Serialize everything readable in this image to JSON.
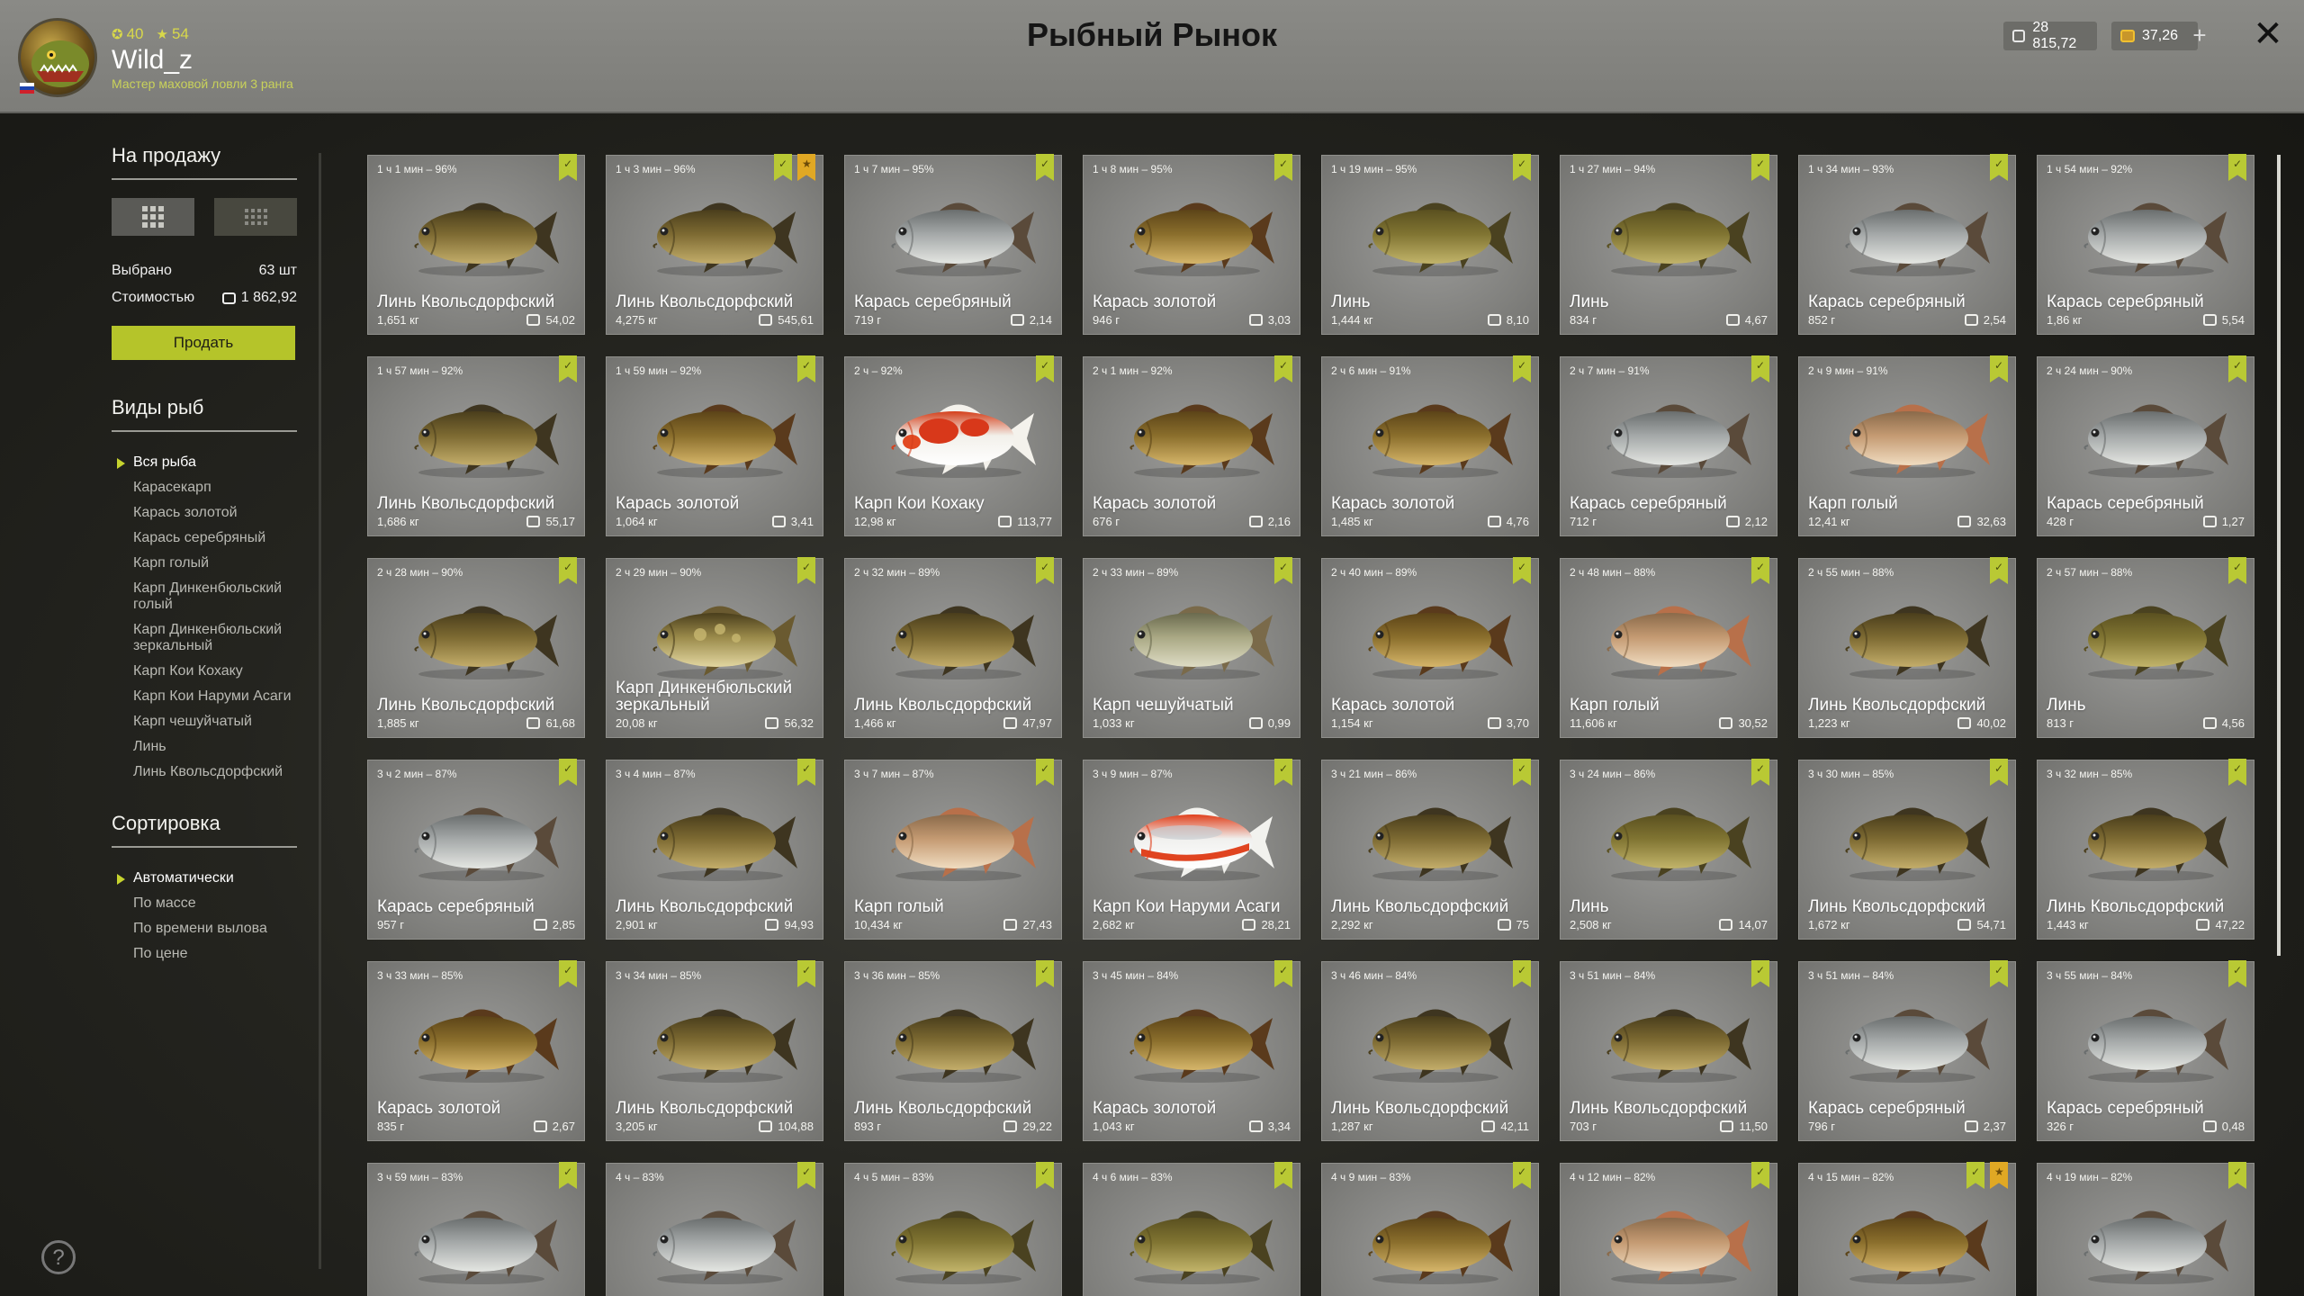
{
  "player": {
    "stat_a": "40",
    "stat_b": "54",
    "username": "Wild_z",
    "rank": "Мастер маховой ловли 3 ранга"
  },
  "title": "Рыбный Рынок",
  "currency": {
    "silver": "28 815,72",
    "gold": "37,26"
  },
  "sidebar": {
    "for_sale_title": "На продажу",
    "selected_label": "Выбрано",
    "selected_value": "63 шт",
    "cost_label": "Стоимостью",
    "cost_value": "1 862,92",
    "sell_label": "Продать",
    "fish_types_title": "Виды рыб",
    "fish_types": [
      "Вся рыба",
      "Карасекарп",
      "Карась золотой",
      "Карась серебряный",
      "Карп голый",
      "Карп Динкенбюльский голый",
      "Карп Динкенбюльский зеркальный",
      "Карп Кои Кохаку",
      "Карп Кои Наруми Асаги",
      "Карп чешуйчатый",
      "Линь",
      "Линь Квольсдорфский"
    ],
    "sort_title": "Сортировка",
    "sort_options": [
      "Автоматически",
      "По массе",
      "По времени вылова",
      "По цене"
    ]
  },
  "colors": {
    "accent": "#b5c42a",
    "tag_gold": "#e0a824"
  },
  "cards": [
    {
      "time": "1 ч 1 мин – 96%",
      "name": "Линь Квольсдорфский",
      "weight": "1,651 кг",
      "price": "54,02",
      "kind": "tench",
      "tags": 1
    },
    {
      "time": "1 ч 3 мин – 96%",
      "name": "Линь Квольсдорфский",
      "weight": "4,275 кг",
      "price": "545,61",
      "kind": "tench",
      "tags": 2
    },
    {
      "time": "1 ч 7 мин – 95%",
      "name": "Карась серебряный",
      "weight": "719 г",
      "price": "2,14",
      "kind": "silver",
      "tags": 1
    },
    {
      "time": "1 ч 8 мин – 95%",
      "name": "Карась золотой",
      "weight": "946 г",
      "price": "3,03",
      "kind": "gold",
      "tags": 1
    },
    {
      "time": "1 ч 19 мин – 95%",
      "name": "Линь",
      "weight": "1,444 кг",
      "price": "8,10",
      "kind": "tench2",
      "tags": 1
    },
    {
      "time": "1 ч 27 мин – 94%",
      "name": "Линь",
      "weight": "834 г",
      "price": "4,67",
      "kind": "tench2",
      "tags": 1
    },
    {
      "time": "1 ч 34 мин – 93%",
      "name": "Карась серебряный",
      "weight": "852 г",
      "price": "2,54",
      "kind": "silver",
      "tags": 1
    },
    {
      "time": "1 ч 54 мин – 92%",
      "name": "Карась серебряный",
      "weight": "1,86 кг",
      "price": "5,54",
      "kind": "silver",
      "tags": 1
    },
    {
      "time": "1 ч 57 мин – 92%",
      "name": "Линь Квольсдорфский",
      "weight": "1,686 кг",
      "price": "55,17",
      "kind": "tench",
      "tags": 1
    },
    {
      "time": "1 ч 59 мин – 92%",
      "name": "Карась золотой",
      "weight": "1,064 кг",
      "price": "3,41",
      "kind": "gold",
      "tags": 1
    },
    {
      "time": "2 ч – 92%",
      "name": "Карп Кои Кохаку",
      "weight": "12,98 кг",
      "price": "113,77",
      "kind": "koi",
      "tags": 1
    },
    {
      "time": "2 ч 1 мин – 92%",
      "name": "Карась золотой",
      "weight": "676 г",
      "price": "2,16",
      "kind": "gold",
      "tags": 1
    },
    {
      "time": "2 ч 6 мин – 91%",
      "name": "Карась золотой",
      "weight": "1,485 кг",
      "price": "4,76",
      "kind": "gold",
      "tags": 1
    },
    {
      "time": "2 ч 7 мин – 91%",
      "name": "Карась серебряный",
      "weight": "712 г",
      "price": "2,12",
      "kind": "silver",
      "tags": 1
    },
    {
      "time": "2 ч 9 мин – 91%",
      "name": "Карп голый",
      "weight": "12,41 кг",
      "price": "32,63",
      "kind": "leather",
      "tags": 1
    },
    {
      "time": "2 ч 24 мин – 90%",
      "name": "Карась серебряный",
      "weight": "428 г",
      "price": "1,27",
      "kind": "silver",
      "tags": 1
    },
    {
      "time": "2 ч 28 мин – 90%",
      "name": "Линь Квольсдорфский",
      "weight": "1,885 кг",
      "price": "61,68",
      "kind": "tench",
      "tags": 1
    },
    {
      "time": "2 ч 29 мин – 90%",
      "name": "Карп Динкенбюльский зеркальный",
      "weight": "20,08 кг",
      "price": "56,32",
      "kind": "mirror",
      "tags": 1
    },
    {
      "time": "2 ч 32 мин – 89%",
      "name": "Линь Квольсдорфский",
      "weight": "1,466 кг",
      "price": "47,97",
      "kind": "tench",
      "tags": 1
    },
    {
      "time": "2 ч 33 мин – 89%",
      "name": "Карп чешуйчатый",
      "weight": "1,033 кг",
      "price": "0,99",
      "kind": "common",
      "tags": 1
    },
    {
      "time": "2 ч 40 мин – 89%",
      "name": "Карась золотой",
      "weight": "1,154 кг",
      "price": "3,70",
      "kind": "gold",
      "tags": 1
    },
    {
      "time": "2 ч 48 мин – 88%",
      "name": "Карп голый",
      "weight": "11,606 кг",
      "price": "30,52",
      "kind": "leather",
      "tags": 1
    },
    {
      "time": "2 ч 55 мин – 88%",
      "name": "Линь Квольсдорфский",
      "weight": "1,223 кг",
      "price": "40,02",
      "kind": "tench",
      "tags": 1
    },
    {
      "time": "2 ч 57 мин – 88%",
      "name": "Линь",
      "weight": "813 г",
      "price": "4,56",
      "kind": "tench2",
      "tags": 1
    },
    {
      "time": "3 ч 2 мин – 87%",
      "name": "Карась серебряный",
      "weight": "957 г",
      "price": "2,85",
      "kind": "silver",
      "tags": 1
    },
    {
      "time": "3 ч 4 мин – 87%",
      "name": "Линь Квольсдорфский",
      "weight": "2,901 кг",
      "price": "94,93",
      "kind": "tench",
      "tags": 1
    },
    {
      "time": "3 ч 7 мин – 87%",
      "name": "Карп голый",
      "weight": "10,434 кг",
      "price": "27,43",
      "kind": "leather",
      "tags": 1
    },
    {
      "time": "3 ч 9 мин – 87%",
      "name": "Карп Кои Наруми Асаги",
      "weight": "2,682 кг",
      "price": "28,21",
      "kind": "asagi",
      "tags": 1
    },
    {
      "time": "3 ч 21 мин – 86%",
      "name": "Линь Квольсдорфский",
      "weight": "2,292 кг",
      "price": "75",
      "kind": "tench",
      "tags": 1
    },
    {
      "time": "3 ч 24 мин – 86%",
      "name": "Линь",
      "weight": "2,508 кг",
      "price": "14,07",
      "kind": "tench2",
      "tags": 1
    },
    {
      "time": "3 ч 30 мин – 85%",
      "name": "Линь Квольсдорфский",
      "weight": "1,672 кг",
      "price": "54,71",
      "kind": "tench",
      "tags": 1
    },
    {
      "time": "3 ч 32 мин – 85%",
      "name": "Линь Квольсдорфский",
      "weight": "1,443 кг",
      "price": "47,22",
      "kind": "tench",
      "tags": 1
    },
    {
      "time": "3 ч 33 мин – 85%",
      "name": "Карась золотой",
      "weight": "835 г",
      "price": "2,67",
      "kind": "gold",
      "tags": 1
    },
    {
      "time": "3 ч 34 мин – 85%",
      "name": "Линь Квольсдорфский",
      "weight": "3,205 кг",
      "price": "104,88",
      "kind": "tench",
      "tags": 1
    },
    {
      "time": "3 ч 36 мин – 85%",
      "name": "Линь Квольсдорфский",
      "weight": "893 г",
      "price": "29,22",
      "kind": "tench",
      "tags": 1
    },
    {
      "time": "3 ч 45 мин – 84%",
      "name": "Карась золотой",
      "weight": "1,043 кг",
      "price": "3,34",
      "kind": "gold",
      "tags": 1
    },
    {
      "time": "3 ч 46 мин – 84%",
      "name": "Линь Квольсдорфский",
      "weight": "1,287 кг",
      "price": "42,11",
      "kind": "tench",
      "tags": 1
    },
    {
      "time": "3 ч 51 мин – 84%",
      "name": "Линь Квольсдорфский",
      "weight": "703 г",
      "price": "11,50",
      "kind": "tench",
      "tags": 1
    },
    {
      "time": "3 ч 51 мин – 84%",
      "name": "Карась серебряный",
      "weight": "796 г",
      "price": "2,37",
      "kind": "silver",
      "tags": 1
    },
    {
      "time": "3 ч 55 мин – 84%",
      "name": "Карась серебряный",
      "weight": "326 г",
      "price": "0,48",
      "kind": "silver",
      "tags": 1
    },
    {
      "time": "3 ч 59 мин – 83%",
      "name": "",
      "weight": "",
      "price": "",
      "kind": "silver",
      "tags": 1
    },
    {
      "time": "4 ч – 83%",
      "name": "",
      "weight": "",
      "price": "",
      "kind": "silver",
      "tags": 1
    },
    {
      "time": "4 ч 5 мин – 83%",
      "name": "",
      "weight": "",
      "price": "",
      "kind": "tench2",
      "tags": 1
    },
    {
      "time": "4 ч 6 мин – 83%",
      "name": "",
      "weight": "",
      "price": "",
      "kind": "tench2",
      "tags": 1
    },
    {
      "time": "4 ч 9 мин – 83%",
      "name": "",
      "weight": "",
      "price": "",
      "kind": "gold",
      "tags": 1
    },
    {
      "time": "4 ч 12 мин – 82%",
      "name": "",
      "weight": "",
      "price": "",
      "kind": "leather",
      "tags": 1
    },
    {
      "time": "4 ч 15 мин – 82%",
      "name": "",
      "weight": "",
      "price": "",
      "kind": "gold",
      "tags": 2
    },
    {
      "time": "4 ч 19 мин – 82%",
      "name": "",
      "weight": "",
      "price": "",
      "kind": "silver",
      "tags": 1
    }
  ]
}
